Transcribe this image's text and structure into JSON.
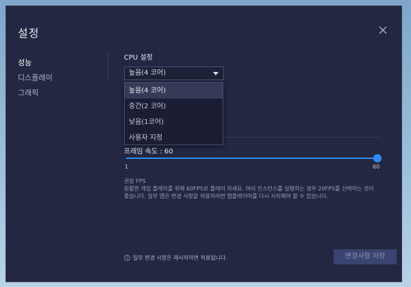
{
  "dialog": {
    "title": "설정",
    "close_icon": "close-icon"
  },
  "sidebar": {
    "items": [
      {
        "label": "성능",
        "active": true
      },
      {
        "label": "디스플레이",
        "active": false
      },
      {
        "label": "그래픽",
        "active": false
      }
    ]
  },
  "cpu": {
    "section_title": "CPU 설정",
    "selected": "높음(4 코어)",
    "options": [
      "높음(4 코어)",
      "중간(2 코어)",
      "낮음(1코어)",
      "사용자 지정"
    ]
  },
  "fps": {
    "label": "프레임 속도 : 60",
    "value": 60,
    "min": 1,
    "max": 60,
    "min_label": "1",
    "max_label": "60",
    "recommend_title": "권장 FPS",
    "recommend_desc": "원활한 게임 플레이를 위해 60FPS로 플레이 하세요. 여러 인스턴스를 실행하는 경우 20FPS를 선택하는 것이 좋습니다. 일부 앱은 변경 사항을 적용하려면 앱플레이어를 다시 시작해야 할 수 있습니다."
  },
  "footer": {
    "note": "일부 변경 사항은 재시작하면 적용됩니다.",
    "apply_label": "변경사항 저장"
  },
  "colors": {
    "accent": "#2e8cf0",
    "panel_bg": "#232741"
  }
}
